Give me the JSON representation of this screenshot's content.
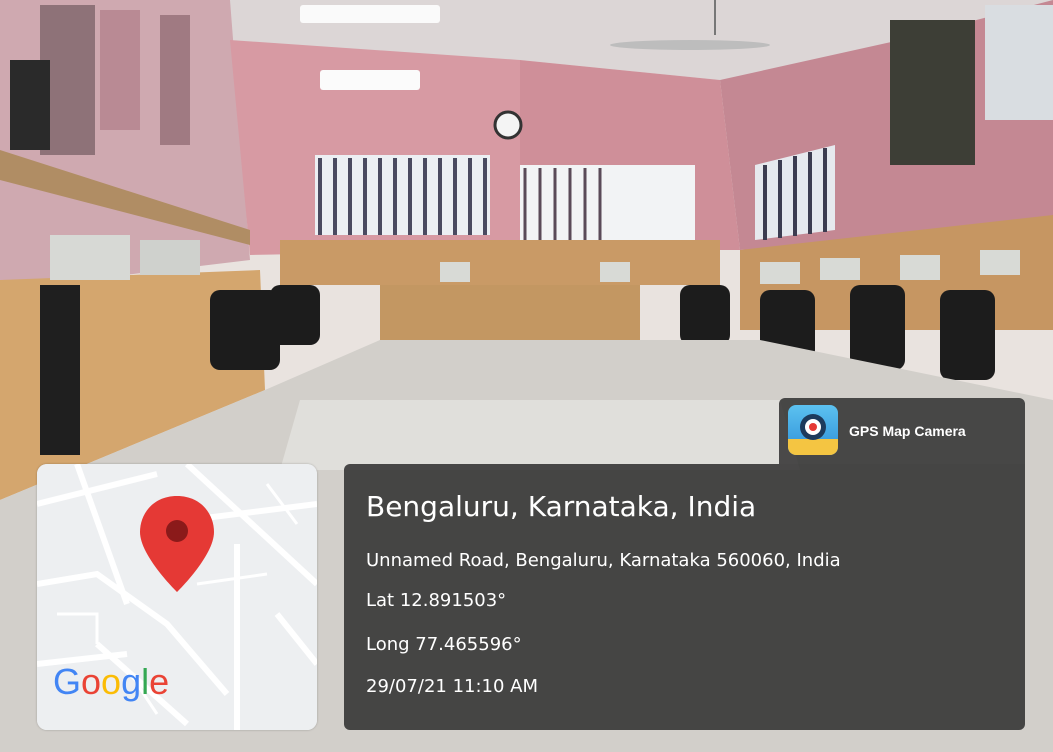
{
  "photo": {
    "subject": "laboratory-room"
  },
  "watermark": {
    "app_name": "GPS Map Camera",
    "app_icon": "gps-map-camera-icon",
    "map_logo": "Google",
    "map_pin_icon": "map-pin-icon",
    "pin_color": "#e53935",
    "location_title": "Bengaluru, Karnataka, India",
    "address": "Unnamed Road, Bengaluru, Karnataka 560060, India",
    "latitude": "Lat 12.891503°",
    "longitude": "Long 77.465596°",
    "datetime": "29/07/21 11:10 AM"
  }
}
